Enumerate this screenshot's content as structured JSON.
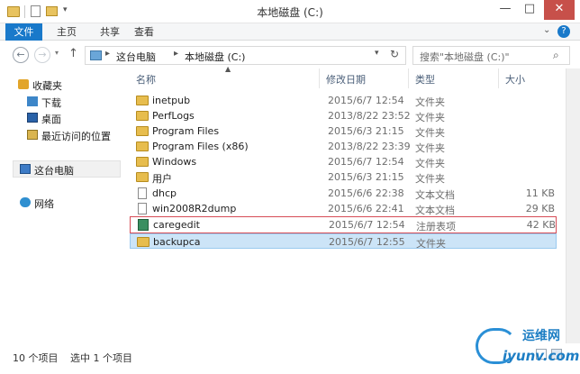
{
  "window": {
    "title": "本地磁盘 (C:)",
    "min_glyph": "—",
    "max_glyph": "□",
    "close_glyph": "✕"
  },
  "ribbon": {
    "tabs": [
      "文件",
      "主页",
      "共享",
      "查看"
    ]
  },
  "address": {
    "crumbs": [
      "这台电脑",
      "本地磁盘 (C:)"
    ],
    "search_placeholder": "搜索\"本地磁盘 (C:)\""
  },
  "sidebar": {
    "groups": [
      {
        "label": "收藏夹",
        "icon": "star-icon"
      },
      {
        "label": "下载",
        "icon": "download-folder-icon"
      },
      {
        "label": "桌面",
        "icon": "desktop-icon"
      },
      {
        "label": "最近访问的位置",
        "icon": "recent-places-icon"
      },
      {
        "label": "这台电脑",
        "icon": "computer-icon"
      },
      {
        "label": "网络",
        "icon": "network-icon"
      }
    ]
  },
  "columns": [
    "名称",
    "修改日期",
    "类型",
    "大小"
  ],
  "files": [
    {
      "name": "inetpub",
      "date": "2015/6/7 12:54",
      "type": "文件夹",
      "size": "",
      "icon": "folder-icon"
    },
    {
      "name": "PerfLogs",
      "date": "2013/8/22 23:52",
      "type": "文件夹",
      "size": "",
      "icon": "folder-icon"
    },
    {
      "name": "Program Files",
      "date": "2015/6/3 21:15",
      "type": "文件夹",
      "size": "",
      "icon": "folder-icon"
    },
    {
      "name": "Program Files (x86)",
      "date": "2013/8/22 23:39",
      "type": "文件夹",
      "size": "",
      "icon": "folder-icon"
    },
    {
      "name": "Windows",
      "date": "2015/6/7 12:54",
      "type": "文件夹",
      "size": "",
      "icon": "folder-icon"
    },
    {
      "name": "用户",
      "date": "2015/6/3 21:15",
      "type": "文件夹",
      "size": "",
      "icon": "folder-icon"
    },
    {
      "name": "dhcp",
      "date": "2015/6/6 22:38",
      "type": "文本文档",
      "size": "11 KB",
      "icon": "text-document-icon"
    },
    {
      "name": "win2008R2dump",
      "date": "2015/6/6 22:41",
      "type": "文本文档",
      "size": "29 KB",
      "icon": "text-document-icon"
    },
    {
      "name": "caregedit",
      "date": "2015/6/7 12:54",
      "type": "注册表项",
      "size": "42 KB",
      "icon": "registry-file-icon"
    },
    {
      "name": "backupca",
      "date": "2015/6/7 12:55",
      "type": "文件夹",
      "size": "",
      "icon": "folder-icon"
    }
  ],
  "status": {
    "count": "10 个项目",
    "selected": "选中 1 个项目"
  },
  "watermark": {
    "cn": "运维网",
    "en": "iyunv.com"
  }
}
